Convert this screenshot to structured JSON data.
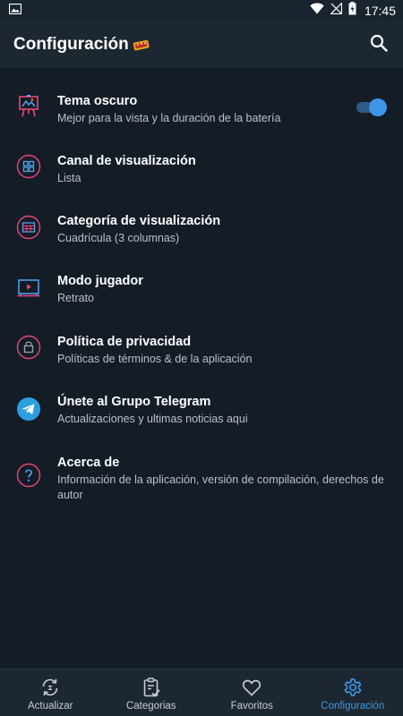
{
  "status_bar": {
    "time": "17:45",
    "icons": [
      "image-icon",
      "wifi-icon",
      "no-signal-icon",
      "battery-charging-icon"
    ]
  },
  "app_bar": {
    "title": "Configuración",
    "search_icon": "search-icon"
  },
  "settings": [
    {
      "title": "Tema oscuro",
      "subtitle": "Mejor para la vista y la duración de la batería",
      "icon": "theme-easel-icon",
      "toggle_on": true
    },
    {
      "title": "Canal de visualización",
      "subtitle": "Lista",
      "icon": "grid-icon"
    },
    {
      "title": "Categoría de visualización",
      "subtitle": "Cuadrícula (3 columnas)",
      "icon": "table-icon"
    },
    {
      "title": "Modo jugador",
      "subtitle": "Retrato",
      "icon": "tv-player-icon"
    },
    {
      "title": "Política de privacidad",
      "subtitle": "Políticas de términos & de la aplicación",
      "icon": "lock-icon"
    },
    {
      "title": "Únete al Grupo Telegram",
      "subtitle": "Actualizaciones y ultimas noticias aqui",
      "icon": "telegram-icon"
    },
    {
      "title": "Acerca de",
      "subtitle_line1": "Información de la aplicación, versión de compilación, derechos de",
      "subtitle_line2": "autor",
      "icon": "question-icon"
    }
  ],
  "bottom_nav": [
    {
      "label": "Actualizar",
      "icon": "refresh-icon",
      "active": false
    },
    {
      "label": "Categorias",
      "icon": "clipboard-check-icon",
      "active": false
    },
    {
      "label": "Favoritos",
      "icon": "heart-icon",
      "active": false
    },
    {
      "label": "Configuración",
      "icon": "gear-icon",
      "active": true
    }
  ],
  "colors": {
    "background": "#141d26",
    "bar": "#1d2731",
    "accent": "#3f96e6",
    "subtitle": "#b9c0c7"
  }
}
